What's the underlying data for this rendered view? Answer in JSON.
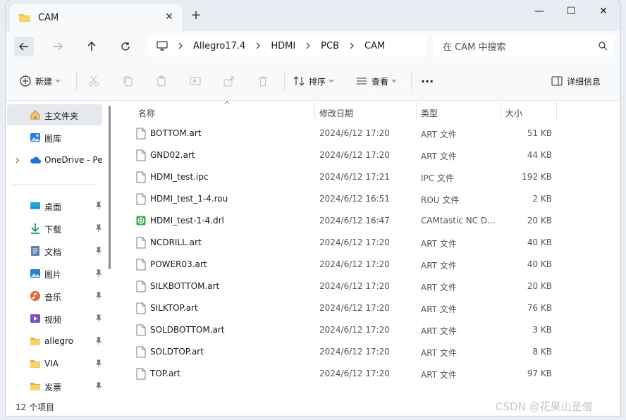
{
  "tab": {
    "title": "CAM",
    "close": "✕",
    "new": "+"
  },
  "window_controls": {
    "minimize": "—",
    "maximize": "☐",
    "close": "✕"
  },
  "breadcrumb": [
    "Allegro17.4",
    "HDMI",
    "PCB",
    "CAM"
  ],
  "search": {
    "placeholder": "在 CAM 中搜索"
  },
  "toolbar": {
    "new_label": "新建",
    "sort_label": "排序",
    "view_label": "查看",
    "more_label": "···",
    "details_label": "详细信息"
  },
  "sidebar": {
    "items": [
      {
        "label": "主文件夹",
        "icon": "home-icon"
      },
      {
        "label": "图库",
        "icon": "gallery-icon"
      },
      {
        "label": "OneDrive - Per",
        "icon": "cloud-icon"
      },
      {
        "label": "桌面",
        "icon": "desktop-icon"
      },
      {
        "label": "下载",
        "icon": "download-icon"
      },
      {
        "label": "文档",
        "icon": "documents-icon"
      },
      {
        "label": "图片",
        "icon": "pictures-icon"
      },
      {
        "label": "音乐",
        "icon": "music-icon"
      },
      {
        "label": "视频",
        "icon": "videos-icon"
      },
      {
        "label": "allegro",
        "icon": "folder-icon"
      },
      {
        "label": "VIA",
        "icon": "folder-icon"
      },
      {
        "label": "发票",
        "icon": "folder-icon"
      }
    ]
  },
  "columns": {
    "name": "名称",
    "date": "修改日期",
    "type": "类型",
    "size": "大小"
  },
  "files": [
    {
      "name": "BOTTOM.art",
      "date": "2024/6/12 17:20",
      "type": "ART 文件",
      "size": "51 KB"
    },
    {
      "name": "GND02.art",
      "date": "2024/6/12 17:20",
      "type": "ART 文件",
      "size": "44 KB"
    },
    {
      "name": "HDMI_test.ipc",
      "date": "2024/6/12 17:21",
      "type": "IPC 文件",
      "size": "192 KB"
    },
    {
      "name": "HDMI_test_1-4.rou",
      "date": "2024/6/12 16:51",
      "type": "ROU 文件",
      "size": "2 KB"
    },
    {
      "name": "HDMI_test-1-4.drl",
      "date": "2024/6/12 16:47",
      "type": "CAMtastic NC D...",
      "size": "20 KB"
    },
    {
      "name": "NCDRILL.art",
      "date": "2024/6/12 17:20",
      "type": "ART 文件",
      "size": "40 KB"
    },
    {
      "name": "POWER03.art",
      "date": "2024/6/12 17:20",
      "type": "ART 文件",
      "size": "40 KB"
    },
    {
      "name": "SILKBOTTOM.art",
      "date": "2024/6/12 17:20",
      "type": "ART 文件",
      "size": "20 KB"
    },
    {
      "name": "SILKTOP.art",
      "date": "2024/6/12 17:20",
      "type": "ART 文件",
      "size": "76 KB"
    },
    {
      "name": "SOLDBOTTOM.art",
      "date": "2024/6/12 17:20",
      "type": "ART 文件",
      "size": "3 KB"
    },
    {
      "name": "SOLDTOP.art",
      "date": "2024/6/12 17:20",
      "type": "ART 文件",
      "size": "8 KB"
    },
    {
      "name": "TOP.art",
      "date": "2024/6/12 17:20",
      "type": "ART 文件",
      "size": "97 KB"
    }
  ],
  "status": {
    "count": "12 个项目"
  },
  "watermark": "CSDN @花果山圣僧",
  "colors": {
    "folder": "#f2c14e",
    "accent": "#0067c0"
  }
}
